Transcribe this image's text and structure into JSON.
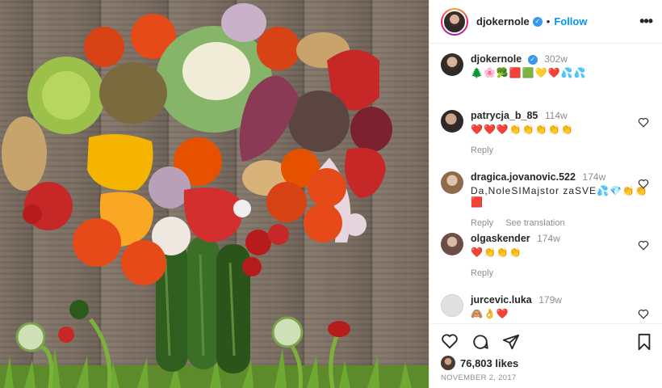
{
  "post": {
    "username": "djokernole",
    "follow_label": "Follow",
    "more_label": "•••",
    "caption_author": "djokernole",
    "caption_age": "302w",
    "caption_text": "🌲🌸🥦🟥🟩💛❤️💦💦",
    "likes_count": "76,803 likes",
    "date": "NOVEMBER 2, 2017"
  },
  "comments": [
    {
      "user": "patrycja_b_85",
      "age": "114w",
      "text": "❤️❤️❤️👏👏👏👏👏",
      "actions": [
        "Reply"
      ]
    },
    {
      "user": "dragica.jovanovic.522",
      "age": "174w",
      "text": "Da,NoleSIMajstor zaSVE💦💎👏👏🟥",
      "actions": [
        "Reply",
        "See translation"
      ]
    },
    {
      "user": "olgaskender",
      "age": "174w",
      "text": "❤️👏👏👏",
      "actions": [
        "Reply"
      ]
    },
    {
      "user": "jurcevic.luka",
      "age": "179w",
      "text": "🙈👌❤️",
      "actions": []
    }
  ],
  "colors": {
    "accent": "#0095f6",
    "verified": "#3897f0",
    "muted": "#8e8e8e",
    "heart": "#c1121f"
  },
  "icons": [
    "verified-badge-icon",
    "heart-icon",
    "comment-icon",
    "share-icon",
    "bookmark-icon",
    "more-options-icon"
  ]
}
